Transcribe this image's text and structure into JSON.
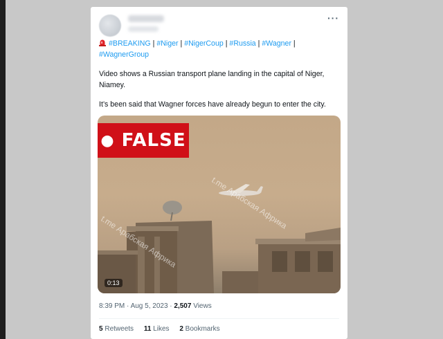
{
  "tweet": {
    "hashtags": [
      "#BREAKING",
      "#Niger",
      "#NigerCoup",
      "#Russia",
      "#Wagner",
      "#WagnerGroup"
    ],
    "separator": "|",
    "text_1": "Video shows a Russian transport plane landing in the capital of Niger, Niamey.",
    "text_2": "It’s been said that Wagner forces have already begun to enter the city.",
    "timestamp": "8:39 PM · Aug 5, 2023 ·",
    "views_count": "2,507",
    "views_label": "Views",
    "retweets_count": "5",
    "retweets_label": "Retweets",
    "likes_count": "11",
    "likes_label": "Likes",
    "bookmarks_count": "2",
    "bookmarks_label": "Bookmarks"
  },
  "media": {
    "badge": "FALSE",
    "watermark_1": "t.me Арабская Африка",
    "watermark_2": "t.me Арабская Африка",
    "duration": "0:13"
  },
  "colors": {
    "link": "#1d9bf0",
    "badge_red": "#d01018",
    "background": "#c8c8c8"
  },
  "icons": [
    "siren-icon",
    "more-options-icon"
  ]
}
